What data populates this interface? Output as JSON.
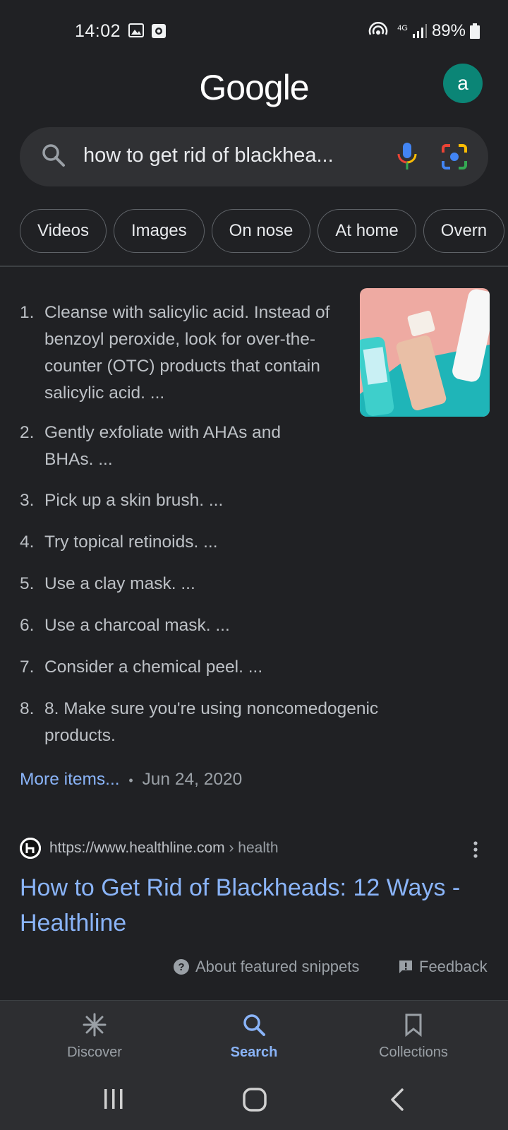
{
  "status_bar": {
    "time": "14:02",
    "network": "4G",
    "battery": "89%"
  },
  "header": {
    "logo": "Google",
    "avatar_letter": "a",
    "avatar_color": "#0b8576"
  },
  "search": {
    "query": "how to get rid of blackhea..."
  },
  "chips": [
    "Videos",
    "Images",
    "On nose",
    "At home",
    "Overn"
  ],
  "snippet": {
    "items": [
      {
        "num": "1.",
        "text": "Cleanse with salicylic acid. Instead of benzoyl peroxide, look for over-the-counter (OTC) products that contain salicylic acid. ..."
      },
      {
        "num": "2.",
        "text": "Gently exfoliate with AHAs and BHAs. ..."
      },
      {
        "num": "3.",
        "text": "Pick up a skin brush. ..."
      },
      {
        "num": "4.",
        "text": "Try topical retinoids. ..."
      },
      {
        "num": "5.",
        "text": "Use a clay mask. ..."
      },
      {
        "num": "6.",
        "text": "Use a charcoal mask. ..."
      },
      {
        "num": "7.",
        "text": "Consider a chemical peel. ..."
      },
      {
        "num": "8.",
        "text": "8. Make sure you're using noncomedogenic products."
      }
    ],
    "more_items": "More items...",
    "separator": "•",
    "date": "Jun 24, 2020"
  },
  "result": {
    "url": "https://www.healthline.com",
    "breadcrumb": "› health",
    "title": "How to Get Rid of Blackheads: 12 Ways - Healthline"
  },
  "footer": {
    "about": "About featured snippets",
    "feedback": "Feedback"
  },
  "bottom_nav": {
    "discover": "Discover",
    "search": "Search",
    "collections": "Collections"
  },
  "colors": {
    "background": "#202124",
    "link": "#8ab4f8",
    "text": "#bdc1c6"
  }
}
